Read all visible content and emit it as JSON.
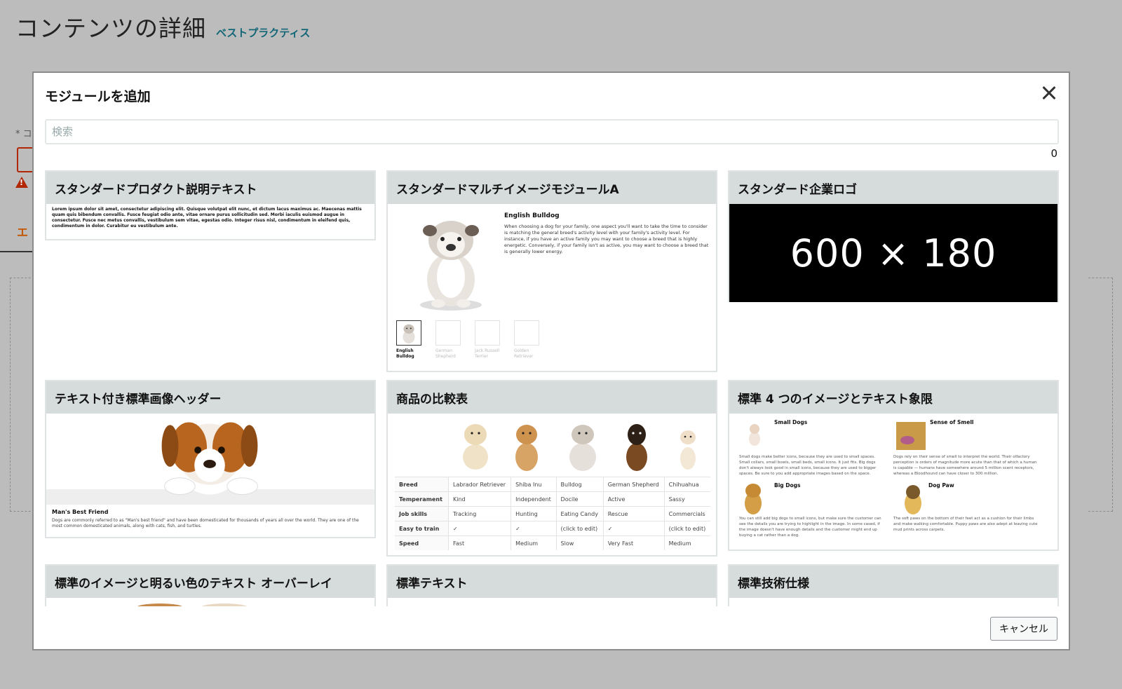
{
  "page": {
    "title": "コンテンツの詳細",
    "best_practices_link": "ベストプラクティス",
    "tab_partial": "エ",
    "required_mark": "* コ"
  },
  "modal": {
    "title": "モジュールを追加",
    "search_placeholder": "検索",
    "result_count": "0",
    "cancel_label": "キャンセル",
    "cards": [
      {
        "title": "スタンダードプロダクト説明テキスト",
        "preview_text": "Lorem ipsum dolor sit amet, consectetur adipiscing elit. Quisque volutpat elit nunc, et dictum lacus maximus ac. Maecenas mattis quam quis bibendum convallis. Fusce feugiat odio ante, vitae ornare purus sollicitudin sed. Morbi iaculis euismod augue in consectetur. Fusce nec metus convallis, vestibulum sem vitae, egestas odio. Integer risus nisl, condimentum in eleifend quis, condimentum in dolor. Curabitur eu vestibulum ante."
      },
      {
        "title": "スタンダードマルチイメージモジュールA",
        "preview_heading": "English Bulldog",
        "preview_text": "When choosing a dog for your family, one aspect you'll want to take the time to consider is matching the general breed's activity level with your family's activity level. For instance, if you have an active family you may want to choose a breed that is highly energetic. Conversely, if your family isn't as active, you may want to choose a breed that is generally lower energy.",
        "thumbs": [
          "English Bulldog",
          "German Shepherd",
          "Jack Russell Terrier",
          "Golden Retriever"
        ]
      },
      {
        "title": "スタンダード企業ロゴ",
        "placeholder": "600 × 180"
      },
      {
        "title": "テキスト付き標準画像ヘッダー",
        "caption_title": "Man's Best Friend",
        "caption_text": "Dogs are commonly referred to as \"Man's best friend\" and have been domesticated for thousands of years all over the world. They are one of the most common domesticated animals, along with cats, fish, and turtles."
      },
      {
        "title": "商品の比較表",
        "rows": [
          [
            "Breed",
            "Labrador Retriever",
            "Shiba Inu",
            "Bulldog",
            "German Shepherd",
            "Chihuahua"
          ],
          [
            "Temperament",
            "Kind",
            "Independent",
            "Docile",
            "Active",
            "Sassy"
          ],
          [
            "Job skills",
            "Tracking",
            "Hunting",
            "Eating Candy",
            "Rescue",
            "Commercials"
          ],
          [
            "Easy to train",
            "✓",
            "✓",
            "(click to edit)",
            "✓",
            "(click to edit)"
          ],
          [
            "Speed",
            "Fast",
            "Medium",
            "Slow",
            "Very Fast",
            "Medium"
          ]
        ]
      },
      {
        "title": "標準 4 つのイメージとテキスト象限",
        "quadrants": [
          {
            "title": "Small Dogs",
            "text": "Small dogs make better icons, because they are used to small spaces. Small collars, small bowls, small beds, small icons. It just fits. Big dogs don't always look good in small icons, because they are used to bigger spaces. Be sure to you add appropriate images based on the space."
          },
          {
            "title": "Sense of Smell",
            "text": "Dogs rely on their sense of smell to interpret the world. Their olfactory perception is orders of magnitude more acute than that of which a human is capable — humans have somewhere around 5 million scent receptors, whereas a Bloodhound can have closer to 300 million."
          },
          {
            "title": "Big Dogs",
            "text": "You can still add big dogs to small icons, but make sure the customer can see the details you are trying to highlight in the image. In some cased, if the image doesn't have enough details and the customer might end up buying a cat rather than a dog."
          },
          {
            "title": "Dog Paw",
            "text": "The soft paws on the bottom of their feet act as a cushion for their limbs and make walking comfortable. Puppy paws are also adept at leaving cute mud prints across carpets."
          }
        ]
      },
      {
        "title": "標準のイメージと明るい色のテキスト オーバーレイ"
      },
      {
        "title": "標準テキスト"
      },
      {
        "title": "標準技術仕様"
      }
    ]
  },
  "colors": {
    "overlay_bg": "#bcbcbc",
    "card_header_bg": "#d6dbdb",
    "link": "#136677",
    "error": "#b12704"
  }
}
